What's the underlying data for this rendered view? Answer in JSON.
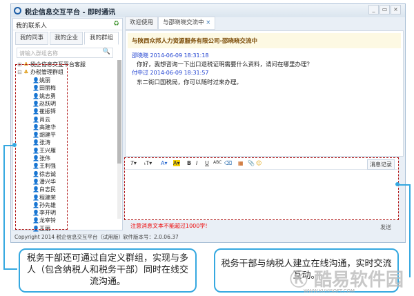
{
  "window": {
    "title": "税企信息交互平台 - 即时通讯",
    "controls": [
      "_",
      "▭",
      "×"
    ]
  },
  "left": {
    "header": "我的联系人",
    "tabs": [
      "我的同事",
      "我的企业",
      "我的群组"
    ],
    "active_tab": 2,
    "search_placeholder": "请输入群组名称",
    "groups": [
      "税企信息交互平台客服",
      "办税管理群组"
    ],
    "members": [
      "姚丽",
      "田丽梅",
      "姚志勇",
      "赵跃明",
      "崔振铎",
      "肖云",
      "高建华",
      "胡建平",
      "张涛",
      "王兴雁",
      "张伟",
      "王利强",
      "徐志诚",
      "潘兴华",
      "白志民",
      "程建荣",
      "孙先雄",
      "李开明",
      "龙宰铃",
      "王丽"
    ]
  },
  "chat": {
    "tabs": [
      "欢迎使用",
      "与邵晓晓交流中"
    ],
    "header": "与陕西众邦人力资源服务有限公司-邵晓晓交流中",
    "messages": [
      {
        "sender": "邵晓晓",
        "time": "2014-06-09 18:31:18",
        "text": "你好，我想咨询一下出口退税证明需要什么资料，请问在哪里办理？"
      },
      {
        "sender": "付中过",
        "time": "2014-06-09 18:31:57",
        "text": "东二街口国税局，你可以随时过来办理。"
      }
    ],
    "toolbar": [
      "T▾",
      "ₜT▾",
      "A▾",
      "A▾",
      "B",
      "I",
      "U",
      "ABC",
      "⌫",
      "▦",
      "📎",
      "☺"
    ],
    "history": "消息记录",
    "warning": "注意消息文本不能超过1000字!",
    "send": "发送"
  },
  "status": {
    "copyright": "Copyright 2014 税企信息交互平台（试用版）",
    "version": "软件版本号：2.0.06.37"
  },
  "callouts": {
    "left": "税务干部还可通过自定义群组，实现与多人（包含纳税人和税务干部）同时在线交流沟通。",
    "right": "税务干部与纳税人建立在线沟通，实时交流互动。"
  },
  "watermark": {
    "text": "酷易软件园",
    "url": "WWW.KUYISOFT.COM"
  },
  "colors": {
    "accent": "#35a8e0",
    "highlight_box": "#b01818",
    "sender": "#1d3fd0",
    "warning": "#e00000"
  }
}
